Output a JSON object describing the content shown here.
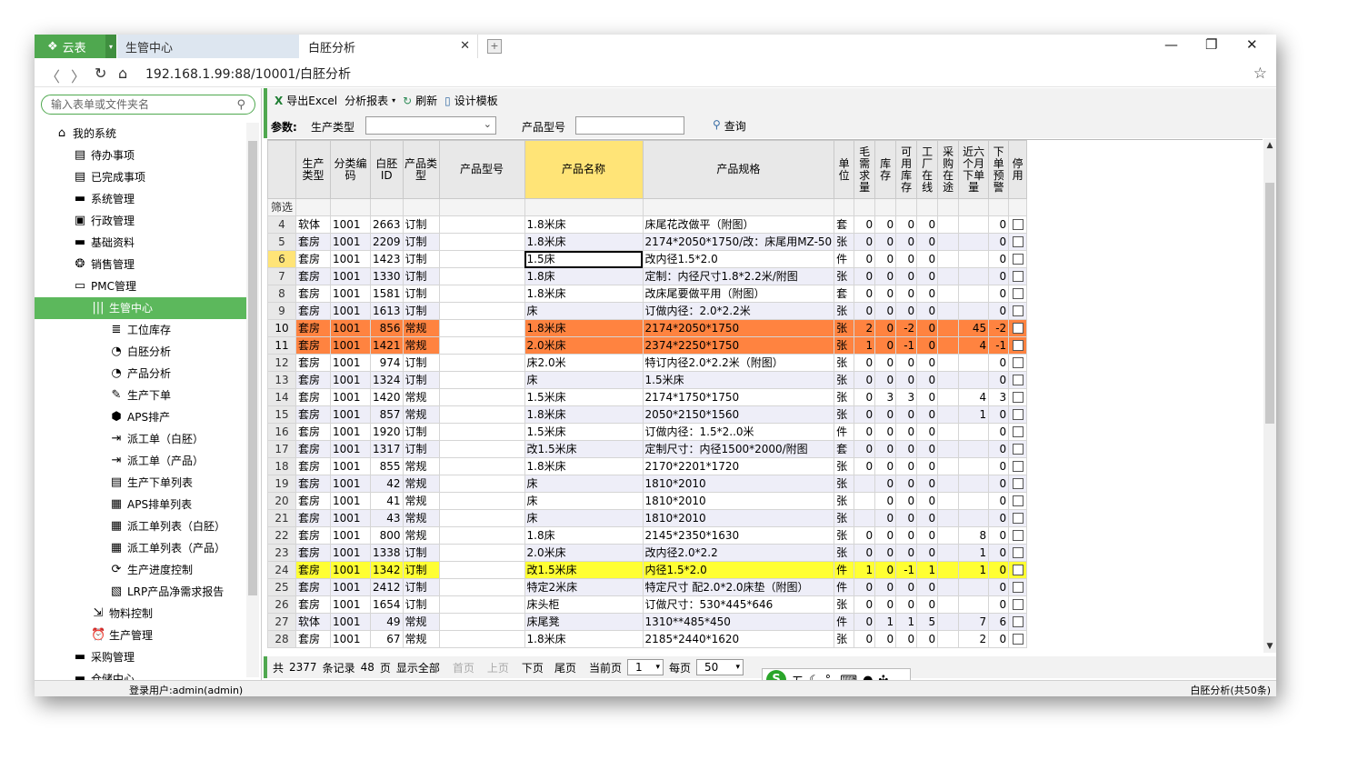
{
  "app": {
    "name": "云表"
  },
  "tabs": [
    {
      "label": "生管中心"
    },
    {
      "label": "白胚分析"
    }
  ],
  "address": {
    "url": "192.168.1.99:88/10001/白胚分析"
  },
  "sidebar": {
    "search_placeholder": "输入表单或文件夹名",
    "items": [
      {
        "label": "我的系统",
        "icon": "home-icon",
        "level": 0
      },
      {
        "label": "待办事项",
        "icon": "list-icon",
        "level": 1
      },
      {
        "label": "已完成事项",
        "icon": "list-icon",
        "level": 1
      },
      {
        "label": "系统管理",
        "icon": "folder-icon",
        "level": 1
      },
      {
        "label": "行政管理",
        "icon": "id-card-icon",
        "level": 1
      },
      {
        "label": "基础资料",
        "icon": "folder-icon",
        "level": 1
      },
      {
        "label": "销售管理",
        "icon": "coins-icon",
        "level": 1
      },
      {
        "label": "PMC管理",
        "icon": "folder-open-icon",
        "level": 1
      },
      {
        "label": "生管中心",
        "icon": "barcode-icon",
        "level": 2,
        "selected": true
      },
      {
        "label": "工位库存",
        "icon": "database-icon",
        "level": 3
      },
      {
        "label": "白胚分析",
        "icon": "chart-ring-icon",
        "level": 3
      },
      {
        "label": "产品分析",
        "icon": "chart-ring-icon",
        "level": 3
      },
      {
        "label": "生产下单",
        "icon": "doc-edit-icon",
        "level": 3
      },
      {
        "label": "APS排产",
        "icon": "cube-icon",
        "level": 3
      },
      {
        "label": "派工单（白胚）",
        "icon": "sign-in-icon",
        "level": 3
      },
      {
        "label": "派工单（产品）",
        "icon": "sign-in-icon",
        "level": 3
      },
      {
        "label": "生产下单列表",
        "icon": "list-icon",
        "level": 3
      },
      {
        "label": "APS排单列表",
        "icon": "grid-list-icon",
        "level": 3
      },
      {
        "label": "派工单列表（白胚）",
        "icon": "grid-list-icon",
        "level": 3
      },
      {
        "label": "派工单列表（产品）",
        "icon": "grid-list-icon",
        "level": 3
      },
      {
        "label": "生产进度控制",
        "icon": "refresh-icon",
        "level": 3
      },
      {
        "label": "LRP产品净需求报告",
        "icon": "report-icon",
        "level": 3
      },
      {
        "label": "物料控制",
        "icon": "import-icon",
        "level": 2
      },
      {
        "label": "生产管理",
        "icon": "alarm-icon",
        "level": 2
      },
      {
        "label": "采购管理",
        "icon": "folder-icon",
        "level": 1
      },
      {
        "label": "仓储中心",
        "icon": "folder-icon",
        "level": 1
      }
    ]
  },
  "toolbar": {
    "export": "导出Excel",
    "analysis": "分析报表",
    "refresh": "刷新",
    "design": "设计模板"
  },
  "params": {
    "label": "参数:",
    "prod_type_label": "生产类型",
    "prod_type_value": "",
    "model_label": "产品型号",
    "model_value": "",
    "query": "查询"
  },
  "table": {
    "filter_label": "筛选",
    "columns": [
      "生产类型",
      "分类编码",
      "白胚ID",
      "产品类型",
      "产品型号",
      "产品名称",
      "产品规格",
      "单位",
      "毛需求量",
      "库存",
      "可用库存",
      "工厂在线",
      "采购在途",
      "近六个月下单量",
      "下单预警",
      "停用"
    ],
    "rows": [
      {
        "n": "4",
        "t": "软体",
        "c": "1001",
        "id": "2663",
        "pt": "订制",
        "m": "",
        "name": "1.8米床",
        "spec": "床尾花改做平（附图）",
        "u": "套",
        "gross": "0",
        "stock": "0",
        "avail": "0",
        "line": "0",
        "po": "",
        "six": "",
        "warn": "0"
      },
      {
        "n": "5",
        "t": "套房",
        "c": "1001",
        "id": "2209",
        "pt": "订制",
        "m": "",
        "name": "1.8米床",
        "spec": "2174*2050*1750/改：床尾用MZ-50",
        "u": "张",
        "gross": "0",
        "stock": "0",
        "avail": "0",
        "line": "0",
        "po": "",
        "six": "",
        "warn": "0"
      },
      {
        "n": "6",
        "t": "套房",
        "c": "1001",
        "id": "1423",
        "pt": "订制",
        "m": "",
        "name": "1.5床",
        "spec": "改内径1.5*2.0",
        "u": "件",
        "gross": "0",
        "stock": "0",
        "avail": "0",
        "line": "0",
        "po": "",
        "six": "",
        "warn": "0"
      },
      {
        "n": "7",
        "t": "套房",
        "c": "1001",
        "id": "1330",
        "pt": "订制",
        "m": "",
        "name": "1.8床",
        "spec": "定制：内径尺寸1.8*2.2米/附图",
        "u": "张",
        "gross": "0",
        "stock": "0",
        "avail": "0",
        "line": "0",
        "po": "",
        "six": "",
        "warn": "0"
      },
      {
        "n": "8",
        "t": "套房",
        "c": "1001",
        "id": "1581",
        "pt": "订制",
        "m": "",
        "name": "1.8米床",
        "spec": "改床尾要做平用（附图）",
        "u": "套",
        "gross": "0",
        "stock": "0",
        "avail": "0",
        "line": "0",
        "po": "",
        "six": "",
        "warn": "0"
      },
      {
        "n": "9",
        "t": "套房",
        "c": "1001",
        "id": "1613",
        "pt": "订制",
        "m": "",
        "name": "床",
        "spec": "订做内径：2.0*2.2米",
        "u": "张",
        "gross": "0",
        "stock": "0",
        "avail": "0",
        "line": "0",
        "po": "",
        "six": "",
        "warn": "0"
      },
      {
        "n": "10",
        "t": "套房",
        "c": "1001",
        "id": "856",
        "pt": "常规",
        "m": "",
        "name": "1.8米床",
        "spec": "2174*2050*1750",
        "u": "张",
        "gross": "2",
        "stock": "0",
        "avail": "-2",
        "line": "0",
        "po": "",
        "six": "45",
        "warn": "-2"
      },
      {
        "n": "11",
        "t": "套房",
        "c": "1001",
        "id": "1421",
        "pt": "常规",
        "m": "",
        "name": "2.0米床",
        "spec": "2374*2250*1750",
        "u": "张",
        "gross": "1",
        "stock": "0",
        "avail": "-1",
        "line": "0",
        "po": "",
        "six": "4",
        "warn": "-1"
      },
      {
        "n": "12",
        "t": "套房",
        "c": "1001",
        "id": "974",
        "pt": "订制",
        "m": "",
        "name": "床2.0米",
        "spec": "特订内径2.0*2.2米（附图）",
        "u": "张",
        "gross": "0",
        "stock": "0",
        "avail": "0",
        "line": "0",
        "po": "",
        "six": "",
        "warn": "0"
      },
      {
        "n": "13",
        "t": "套房",
        "c": "1001",
        "id": "1324",
        "pt": "订制",
        "m": "",
        "name": "床",
        "spec": "1.5米床",
        "u": "张",
        "gross": "0",
        "stock": "0",
        "avail": "0",
        "line": "0",
        "po": "",
        "six": "",
        "warn": "0"
      },
      {
        "n": "14",
        "t": "套房",
        "c": "1001",
        "id": "1420",
        "pt": "常规",
        "m": "",
        "name": "1.5米床",
        "spec": "2174*1750*1750",
        "u": "张",
        "gross": "0",
        "stock": "3",
        "avail": "3",
        "line": "0",
        "po": "",
        "six": "4",
        "warn": "3"
      },
      {
        "n": "15",
        "t": "套房",
        "c": "1001",
        "id": "857",
        "pt": "常规",
        "m": "",
        "name": "1.8米床",
        "spec": "2050*2150*1560",
        "u": "张",
        "gross": "0",
        "stock": "0",
        "avail": "0",
        "line": "0",
        "po": "",
        "six": "1",
        "warn": "0"
      },
      {
        "n": "16",
        "t": "套房",
        "c": "1001",
        "id": "1920",
        "pt": "订制",
        "m": "",
        "name": "1.5米床",
        "spec": "订做内径：1.5*2..0米",
        "u": "件",
        "gross": "0",
        "stock": "0",
        "avail": "0",
        "line": "0",
        "po": "",
        "six": "",
        "warn": "0"
      },
      {
        "n": "17",
        "t": "套房",
        "c": "1001",
        "id": "1317",
        "pt": "订制",
        "m": "",
        "name": "改1.5米床",
        "spec": "定制尺寸：内径1500*2000/附图",
        "u": "套",
        "gross": "0",
        "stock": "0",
        "avail": "0",
        "line": "0",
        "po": "",
        "six": "",
        "warn": "0"
      },
      {
        "n": "18",
        "t": "套房",
        "c": "1001",
        "id": "855",
        "pt": "常规",
        "m": "",
        "name": "1.8米床",
        "spec": "2170*2201*1720",
        "u": "张",
        "gross": "0",
        "stock": "0",
        "avail": "0",
        "line": "0",
        "po": "",
        "six": "",
        "warn": "0"
      },
      {
        "n": "19",
        "t": "套房",
        "c": "1001",
        "id": "42",
        "pt": "常规",
        "m": "",
        "name": "床",
        "spec": "1810*2010",
        "u": "张",
        "gross": "",
        "stock": "0",
        "avail": "0",
        "line": "0",
        "po": "",
        "six": "",
        "warn": "0"
      },
      {
        "n": "20",
        "t": "套房",
        "c": "1001",
        "id": "41",
        "pt": "常规",
        "m": "",
        "name": "床",
        "spec": "1810*2010",
        "u": "张",
        "gross": "",
        "stock": "0",
        "avail": "0",
        "line": "0",
        "po": "",
        "six": "",
        "warn": "0"
      },
      {
        "n": "21",
        "t": "套房",
        "c": "1001",
        "id": "43",
        "pt": "常规",
        "m": "",
        "name": "床",
        "spec": "1810*2010",
        "u": "张",
        "gross": "",
        "stock": "0",
        "avail": "0",
        "line": "0",
        "po": "",
        "six": "",
        "warn": "0"
      },
      {
        "n": "22",
        "t": "套房",
        "c": "1001",
        "id": "800",
        "pt": "常规",
        "m": "",
        "name": "1.8床",
        "spec": "2145*2350*1630",
        "u": "张",
        "gross": "0",
        "stock": "0",
        "avail": "0",
        "line": "0",
        "po": "",
        "six": "8",
        "warn": "0"
      },
      {
        "n": "23",
        "t": "套房",
        "c": "1001",
        "id": "1338",
        "pt": "订制",
        "m": "",
        "name": "2.0米床",
        "spec": "改内径2.0*2.2",
        "u": "张",
        "gross": "0",
        "stock": "0",
        "avail": "0",
        "line": "0",
        "po": "",
        "six": "1",
        "warn": "0"
      },
      {
        "n": "24",
        "t": "套房",
        "c": "1001",
        "id": "1342",
        "pt": "订制",
        "m": "",
        "name": "改1.5米床",
        "spec": "内径1.5*2.0",
        "u": "件",
        "gross": "1",
        "stock": "0",
        "avail": "-1",
        "line": "1",
        "po": "",
        "six": "1",
        "warn": "0"
      },
      {
        "n": "25",
        "t": "套房",
        "c": "1001",
        "id": "2412",
        "pt": "订制",
        "m": "",
        "name": "特定2米床",
        "spec": "特定尺寸 配2.0*2.0床垫（附图）",
        "u": "件",
        "gross": "0",
        "stock": "0",
        "avail": "0",
        "line": "0",
        "po": "",
        "six": "",
        "warn": "0"
      },
      {
        "n": "26",
        "t": "套房",
        "c": "1001",
        "id": "1654",
        "pt": "订制",
        "m": "",
        "name": "床头柜",
        "spec": "订做尺寸：530*445*646",
        "u": "张",
        "gross": "0",
        "stock": "0",
        "avail": "0",
        "line": "0",
        "po": "",
        "six": "",
        "warn": "0"
      },
      {
        "n": "27",
        "t": "软体",
        "c": "1001",
        "id": "49",
        "pt": "常规",
        "m": "",
        "name": "床尾凳",
        "spec": "1310**485*450",
        "u": "件",
        "gross": "0",
        "stock": "1",
        "avail": "1",
        "line": "5",
        "po": "",
        "six": "7",
        "warn": "6"
      },
      {
        "n": "28",
        "t": "套房",
        "c": "1001",
        "id": "67",
        "pt": "常规",
        "m": "",
        "name": "1.8米床",
        "spec": "2185*2440*1620",
        "u": "张",
        "gross": "0",
        "stock": "0",
        "avail": "0",
        "line": "0",
        "po": "",
        "six": "2",
        "warn": "0"
      }
    ]
  },
  "pager": {
    "total_prefix": "共",
    "total": "2377",
    "records": "条记录",
    "pages": "48",
    "page_unit": "页",
    "show_all": "显示全部",
    "first": "首页",
    "prev": "上页",
    "next": "下页",
    "last": "尾页",
    "current_label": "当前页",
    "current": "1",
    "per_page_label": "每页",
    "per_page": "50"
  },
  "ime": {
    "logo": "S",
    "mode": "五"
  },
  "status": {
    "user": "登录用户:admin(admin)",
    "right": "白胚分析(共50条)"
  },
  "colors": {
    "accent": "#4fa84f",
    "orange_row": "#ff8340",
    "yellow_row": "#ffff33",
    "header_highlight": "#ffe477"
  }
}
